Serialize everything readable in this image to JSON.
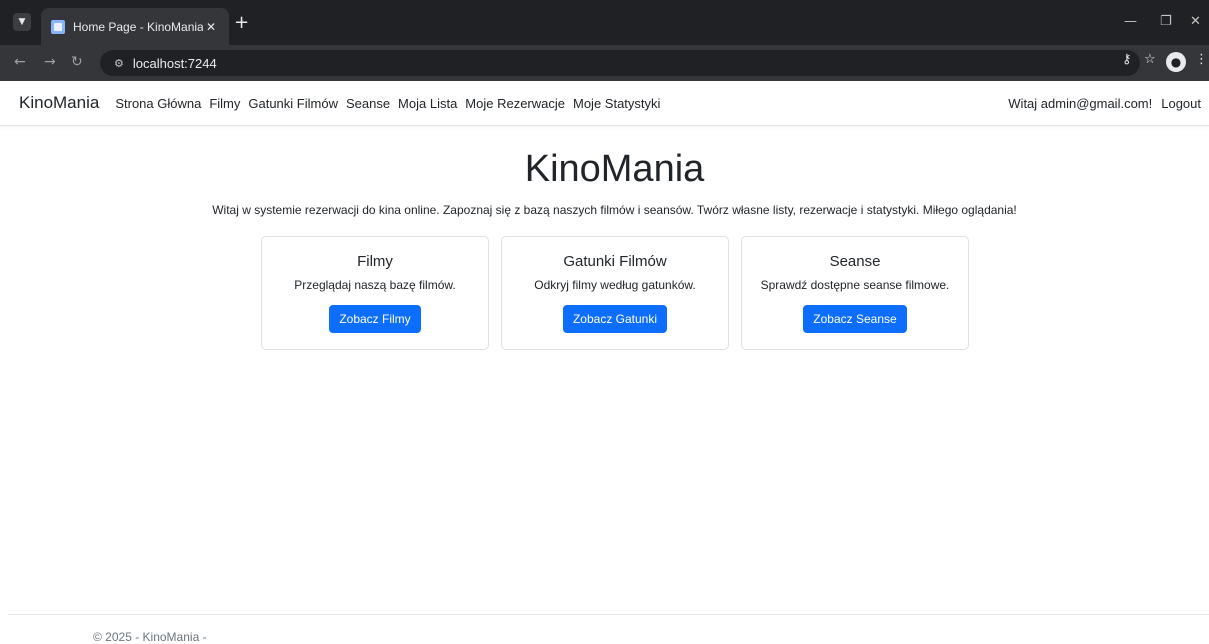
{
  "browser": {
    "tab_title": "Home Page - KinoMania",
    "url": "localhost:7244"
  },
  "navbar": {
    "brand": "KinoMania",
    "links": [
      {
        "label": "Strona Główna"
      },
      {
        "label": "Filmy"
      },
      {
        "label": "Gatunki Filmów"
      },
      {
        "label": "Seanse"
      },
      {
        "label": "Moja Lista"
      },
      {
        "label": "Moje Rezerwacje"
      },
      {
        "label": "Moje Statystyki"
      }
    ],
    "greeting": "Witaj admin@gmail.com!",
    "logout": "Logout"
  },
  "hero": {
    "title": "KinoMania",
    "lead": "Witaj w systemie rezerwacji do kina online. Zapoznaj się z bazą naszych filmów i seansów. Twórz własne listy, rezerwacje i statystyki. Miłego oglądania!"
  },
  "cards": [
    {
      "title": "Filmy",
      "text": "Przeglądaj naszą bazę filmów.",
      "button": "Zobacz Filmy"
    },
    {
      "title": "Gatunki Filmów",
      "text": "Odkryj filmy według gatunków.",
      "button": "Zobacz Gatunki"
    },
    {
      "title": "Seanse",
      "text": "Sprawdź dostępne seanse filmowe.",
      "button": "Zobacz Seanse"
    }
  ],
  "footer": {
    "text": "© 2025 - KinoMania -"
  },
  "colors": {
    "primary_button": "#0d6efd",
    "browser_frame": "#202124"
  }
}
